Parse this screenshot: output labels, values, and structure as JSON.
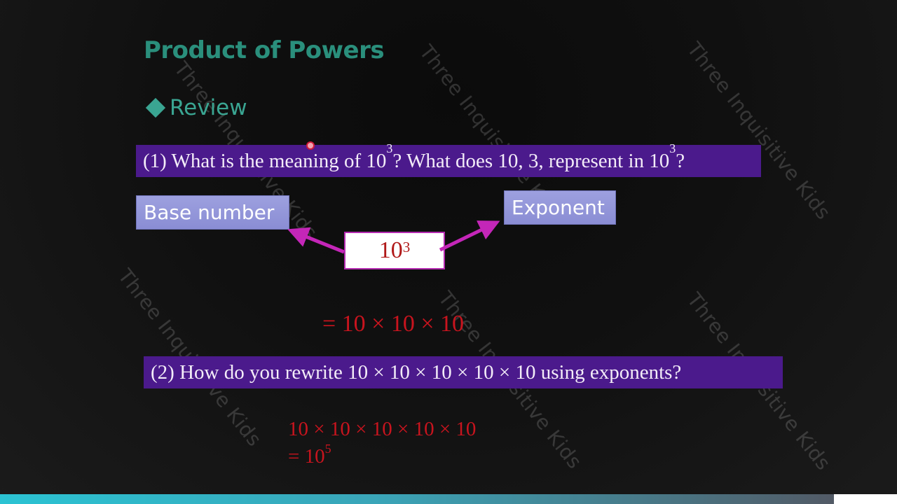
{
  "slide": {
    "title": "Product of Powers",
    "section": "Review",
    "watermark": "Three Inquisitive Kids",
    "question1": {
      "prefix": "(1) What is the meaning of 10",
      "sup1": "3",
      "middle": "? What does 10, 3, represent in 10",
      "sup2": "3",
      "suffix": "?"
    },
    "base_label": "Base number",
    "exponent_label": "Exponent",
    "power": {
      "base": "10",
      "exponent": "3"
    },
    "expansion": "= 10 × 10 × 10",
    "question2": "(2) How do you rewrite 10 × 10 × 10 × 10 × 10 using exponents?",
    "answer_line1": "10 × 10 × 10 × 10 × 10",
    "answer_line2": {
      "prefix": "= 10",
      "exponent": "5"
    }
  },
  "colors": {
    "title": "#2a8f7c",
    "question_bar": "#4b1a8c",
    "label_box": "#9da0df",
    "arrow": "#c426b8",
    "answer_red": "#c8141e"
  },
  "video_progress": {
    "fraction_played": 0.93
  }
}
